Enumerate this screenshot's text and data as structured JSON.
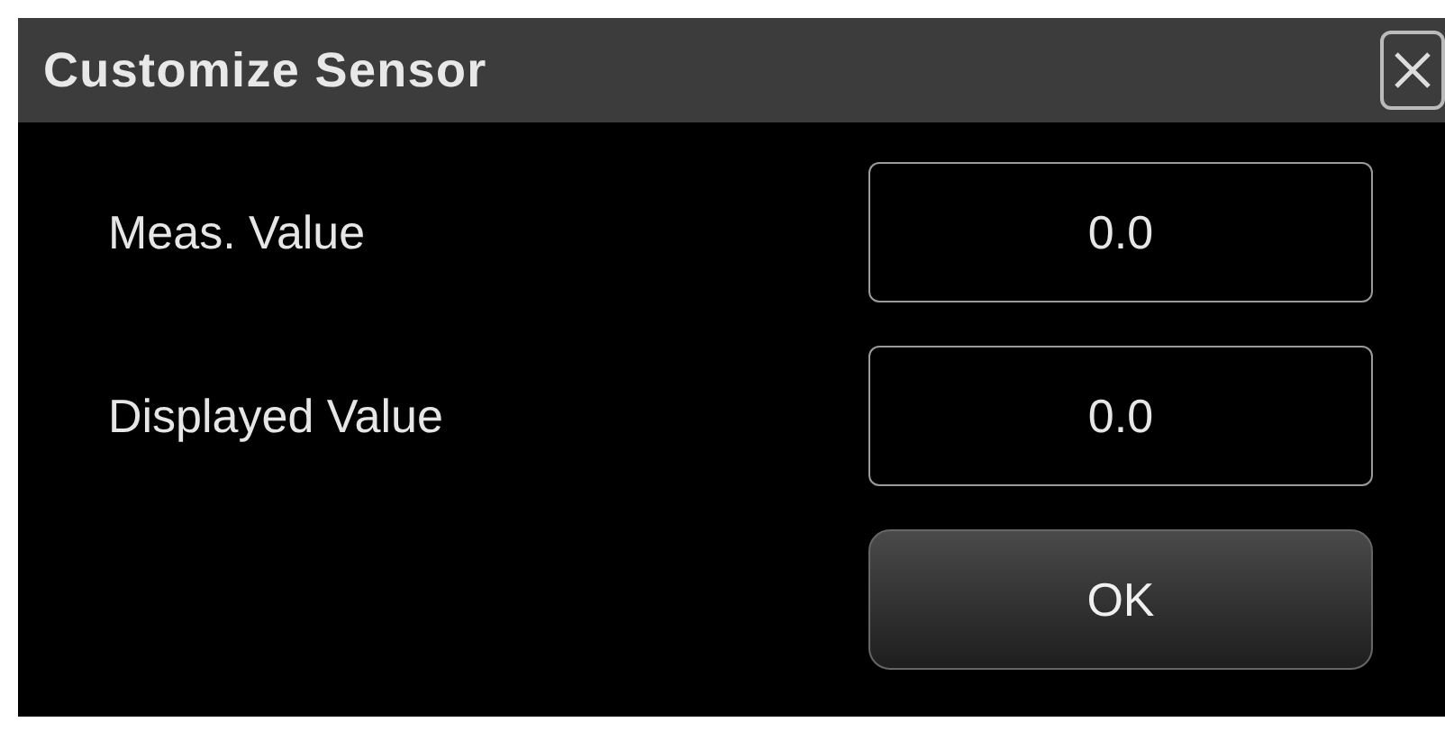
{
  "dialog": {
    "title": "Customize Sensor",
    "fields": [
      {
        "label": "Meas. Value",
        "value": "0.0"
      },
      {
        "label": "Displayed Value",
        "value": "0.0"
      }
    ],
    "buttons": [
      "OK"
    ]
  }
}
